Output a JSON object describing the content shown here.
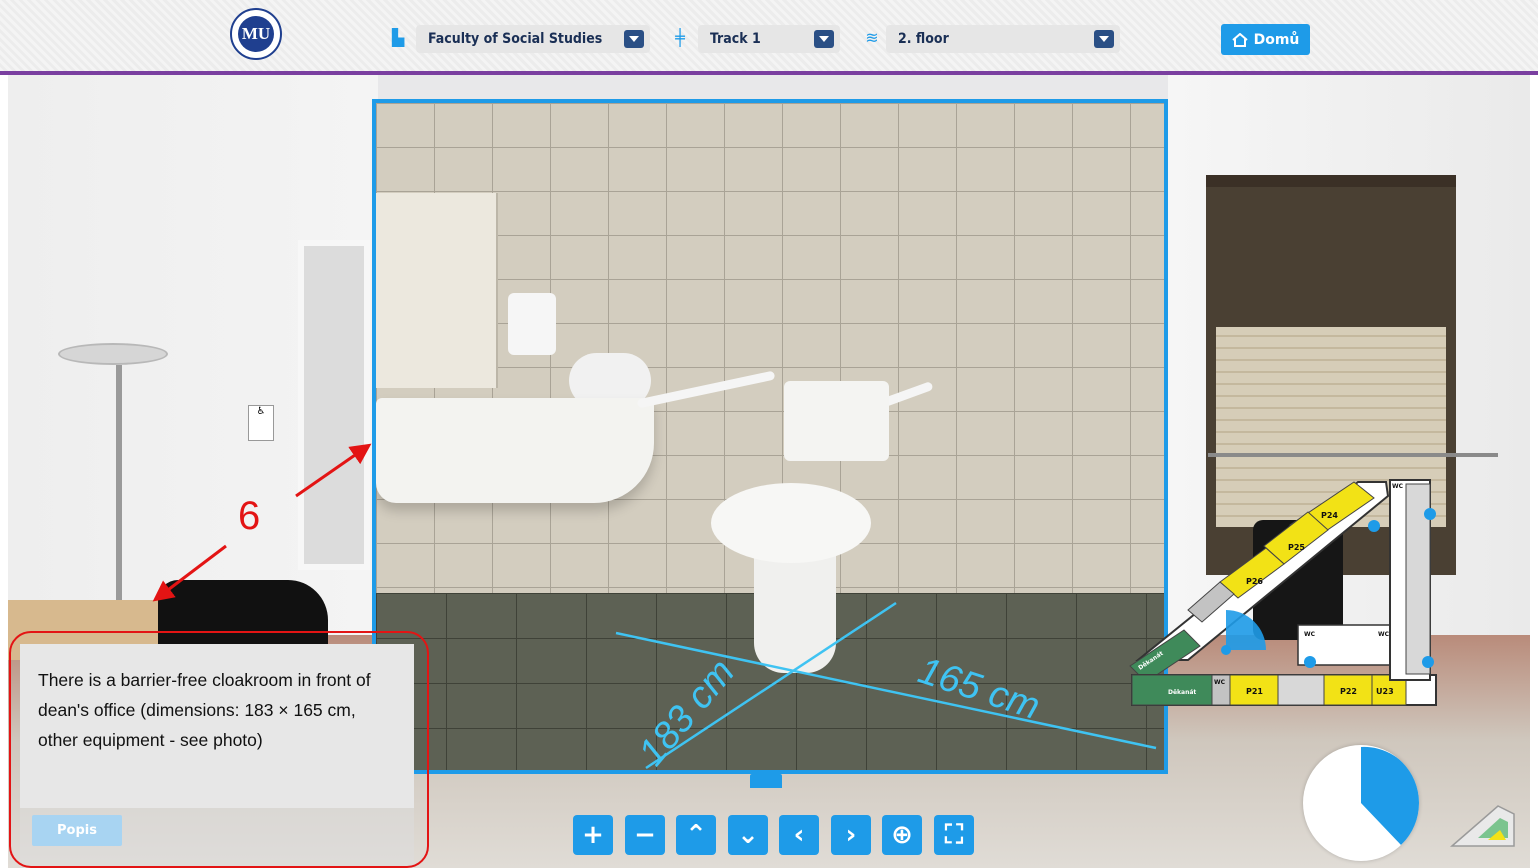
{
  "header": {
    "building": {
      "selected": "Faculty of Social Studies",
      "icon": "building-icon"
    },
    "track": {
      "selected": "Track 1",
      "icon": "signpost-icon"
    },
    "floor": {
      "selected": "2. floor",
      "icon": "layers-icon"
    },
    "home_label": "Domů",
    "home_icon": "home-icon",
    "logo_text": "MU"
  },
  "photo": {
    "measure_depth": "183 cm",
    "measure_width": "165 cm"
  },
  "annotation": {
    "number": "6"
  },
  "description": {
    "text": "There is a barrier-free cloakroom in front of dean's office (dimensions: 183 × 165 cm, other equipment - see photo)",
    "button_label": "Popis"
  },
  "toolbar": [
    {
      "label": "+",
      "name": "zoom-in-button"
    },
    {
      "label": "−",
      "name": "zoom-out-button"
    },
    {
      "label": "⌃",
      "name": "look-up-button"
    },
    {
      "label": "⌄",
      "name": "look-down-button"
    },
    {
      "label": "‹",
      "name": "look-left-button"
    },
    {
      "label": "›",
      "name": "look-right-button"
    },
    {
      "label": "⊕",
      "name": "center-view-button"
    },
    {
      "label": "⛶",
      "name": "fullscreen-button"
    }
  ],
  "floorplan": {
    "rooms": [
      "P24",
      "P25",
      "P26",
      "P21",
      "P22",
      "U23",
      "WC",
      "WC",
      "WC",
      "WC",
      "Děkanát",
      "Děkanát"
    ]
  },
  "colors": {
    "accent": "#1e9be8",
    "header_border": "#7a3fa0",
    "annotation": "#e31414",
    "room_yellow": "#f2e216",
    "room_green": "#3f8a5a"
  }
}
